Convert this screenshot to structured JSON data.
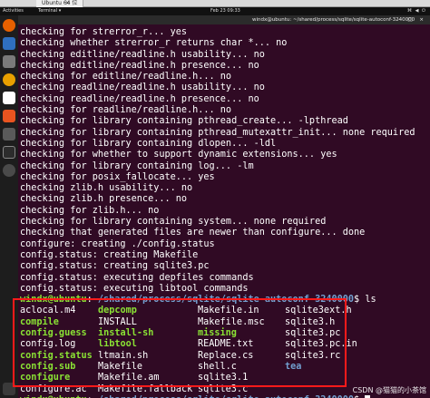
{
  "vm": {
    "tab_title": "Ubuntu 64 位",
    "close_label": "×"
  },
  "topbar": {
    "activities": "Activities",
    "app_name": "Terminal ▾",
    "clock": "Feb 23 09:33",
    "tray": "⌘ ◀ ⏻"
  },
  "titlebar": {
    "title": "windx@ubuntu: ~/shared/process/sqlite/sqlite-autoconf-3240000",
    "controls": "– □ ×"
  },
  "terminal": {
    "lines": [
      "checking for strerror_r... yes",
      "checking whether strerror_r returns char *... no",
      "checking editline/readline.h usability... no",
      "checking editline/readline.h presence... no",
      "checking for editline/readline.h... no",
      "checking readline/readline.h usability... no",
      "checking readline/readline.h presence... no",
      "checking for readline/readline.h... no",
      "checking for library containing pthread_create... -lpthread",
      "checking for library containing pthread_mutexattr_init... none required",
      "checking for library containing dlopen... -ldl",
      "checking for whether to support dynamic extensions... yes",
      "checking for library containing log... -lm",
      "checking for posix_fallocate... yes",
      "checking zlib.h usability... no",
      "checking zlib.h presence... no",
      "checking for zlib.h... no",
      "checking for library containing system... none required",
      "checking that generated files are newer than configure... done",
      "configure: creating ./config.status",
      "config.status: creating Makefile",
      "config.status: creating sqlite3.pc",
      "config.status: executing depfiles commands",
      "config.status: executing libtool commands"
    ],
    "prompt": {
      "user_host": "windx@ubuntu",
      "sep": ":",
      "path": "~/shared/process/sqlite/sqlite-autoconf-3240000",
      "dollar": "$ ",
      "command": "ls"
    },
    "ls_output": [
      {
        "name": "aclocal.m4",
        "kind": "file"
      },
      {
        "name": "depcomp",
        "kind": "exe"
      },
      {
        "name": "Makefile.in",
        "kind": "file"
      },
      {
        "name": "sqlite3ext.h",
        "kind": "file"
      },
      {
        "name": "compile",
        "kind": "exe"
      },
      {
        "name": "INSTALL",
        "kind": "file"
      },
      {
        "name": "Makefile.msc",
        "kind": "file"
      },
      {
        "name": "sqlite3.h",
        "kind": "file"
      },
      {
        "name": "config.guess",
        "kind": "exe"
      },
      {
        "name": "install-sh",
        "kind": "exe"
      },
      {
        "name": "missing",
        "kind": "exe"
      },
      {
        "name": "sqlite3.pc",
        "kind": "file"
      },
      {
        "name": "config.log",
        "kind": "file"
      },
      {
        "name": "libtool",
        "kind": "exe"
      },
      {
        "name": "README.txt",
        "kind": "file"
      },
      {
        "name": "sqlite3.pc.in",
        "kind": "file"
      },
      {
        "name": "config.status",
        "kind": "exe"
      },
      {
        "name": "ltmain.sh",
        "kind": "file"
      },
      {
        "name": "Replace.cs",
        "kind": "file"
      },
      {
        "name": "sqlite3.rc",
        "kind": "file"
      },
      {
        "name": "config.sub",
        "kind": "exe"
      },
      {
        "name": "Makefile",
        "kind": "file"
      },
      {
        "name": "shell.c",
        "kind": "file"
      },
      {
        "name": "tea",
        "kind": "dir"
      },
      {
        "name": "configure",
        "kind": "exe"
      },
      {
        "name": "Makefile.am",
        "kind": "file"
      },
      {
        "name": "sqlite3.1",
        "kind": "file"
      },
      {
        "name": "",
        "kind": "file"
      },
      {
        "name": "configure.ac",
        "kind": "file"
      },
      {
        "name": "Makefile.fallback",
        "kind": "file"
      },
      {
        "name": "sqlite3.c",
        "kind": "file"
      },
      {
        "name": "",
        "kind": "file"
      }
    ]
  },
  "watermark": "CSDN @猫猫的小茶馆",
  "colors": {
    "bg": "#300a24",
    "user": "#8ae234",
    "path": "#729fcf",
    "highlight": "#ff1a1a"
  }
}
